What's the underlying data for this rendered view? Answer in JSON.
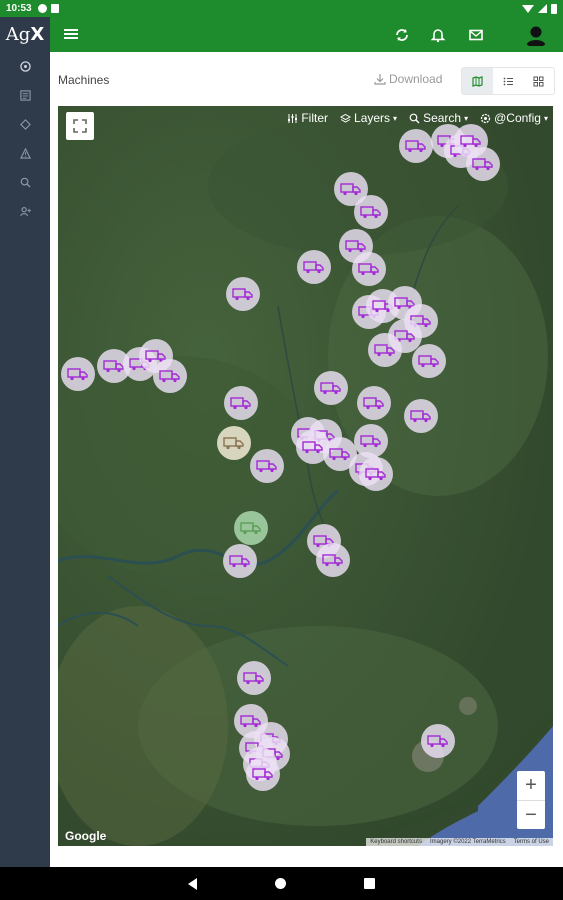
{
  "status_bar": {
    "time": "10:53"
  },
  "sidebar": {
    "logo_prefix": "Ag",
    "logo_suffix": "X",
    "items": [
      {
        "icon": "dashboard-icon"
      },
      {
        "icon": "list-icon"
      },
      {
        "icon": "tag-icon"
      },
      {
        "icon": "alert-icon"
      },
      {
        "icon": "search-icon"
      },
      {
        "icon": "user-add-icon"
      }
    ]
  },
  "topbar": {
    "icons": [
      "refresh-icon",
      "bell-icon",
      "mail-icon",
      "user-icon"
    ]
  },
  "page": {
    "title": "Machines",
    "download_label": "Download"
  },
  "view_toggle": [
    "map-view-icon",
    "list-view-icon",
    "grid-view-icon"
  ],
  "map": {
    "toolbar": {
      "filter": "Filter",
      "layers": "Layers",
      "search": "Search",
      "config": "@Config"
    },
    "zoom_in": "+",
    "zoom_out": "−",
    "google_label": "Google",
    "attribution": [
      "Keyboard shortcuts",
      "Imagery ©2022 TerraMetrics",
      "Terms of Use"
    ]
  },
  "colors": {
    "brand_green": "#1e8b2c",
    "sidebar": "#2f3a4a",
    "marker_purple": "#a32ad6",
    "marker_brown": "#8a7350",
    "marker_green": "#5a9e5a"
  }
}
